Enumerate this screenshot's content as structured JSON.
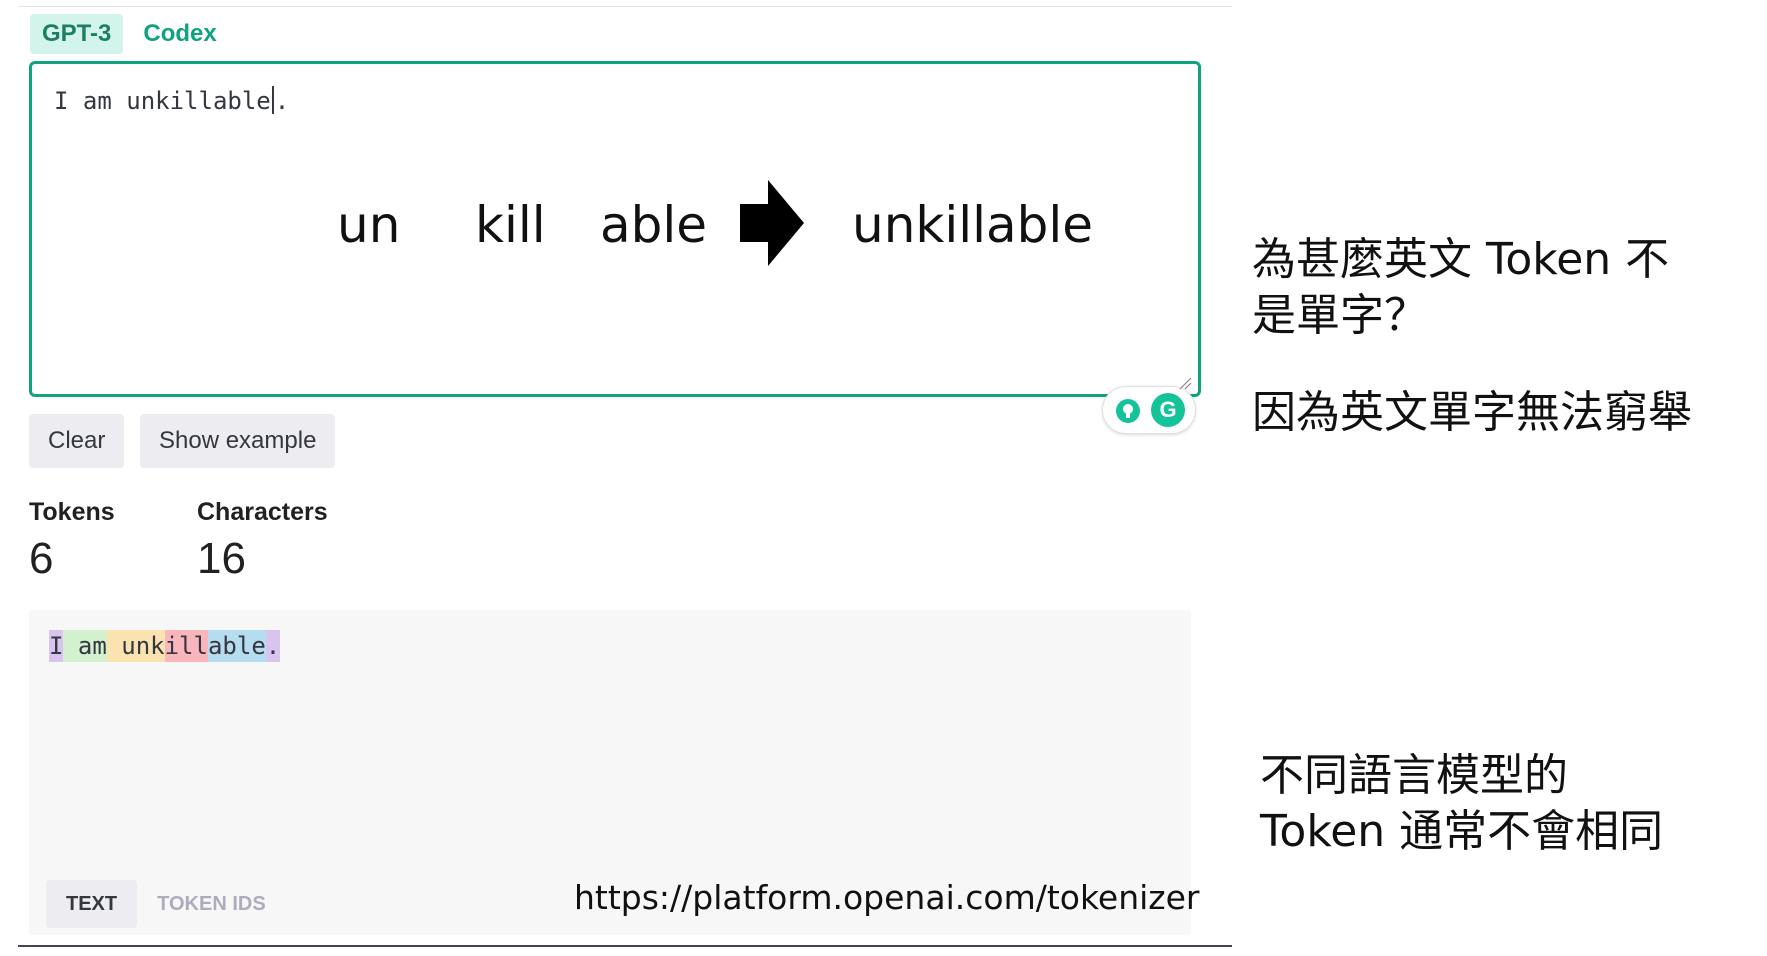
{
  "tabs": [
    {
      "label": "GPT-3",
      "active": true
    },
    {
      "label": "Codex",
      "active": false
    }
  ],
  "input": {
    "text_before_caret": "I am unkillable",
    "text_after_caret": "."
  },
  "overlay": {
    "parts": [
      "un",
      "kill",
      "able"
    ],
    "result": "unkillable"
  },
  "buttons": {
    "clear": "Clear",
    "show_example": "Show example"
  },
  "stats": {
    "tokens_label": "Tokens",
    "tokens_value": "6",
    "characters_label": "Characters",
    "characters_value": "16"
  },
  "output": {
    "tokens": [
      {
        "text": "I",
        "color": "#d9c3ef"
      },
      {
        "text": " am",
        "color": "#d3f0cf"
      },
      {
        "text": " unk",
        "color": "#fbe2b1"
      },
      {
        "text": "ill",
        "color": "#f9b7bd"
      },
      {
        "text": "able",
        "color": "#b5dcef"
      },
      {
        "text": ".",
        "color": "#d9c3ef"
      }
    ],
    "tabs": {
      "text": "TEXT",
      "token_ids": "TOKEN IDS"
    },
    "url": "https://platform.openai.com/tokenizer"
  },
  "notes": {
    "question_line1": "為甚麼英文 Token 不",
    "question_line2": "是單字？",
    "answer": "因為英文單字無法窮舉",
    "footer_line1": "不同語言模型的",
    "footer_line2": "Token 通常不會相同"
  }
}
